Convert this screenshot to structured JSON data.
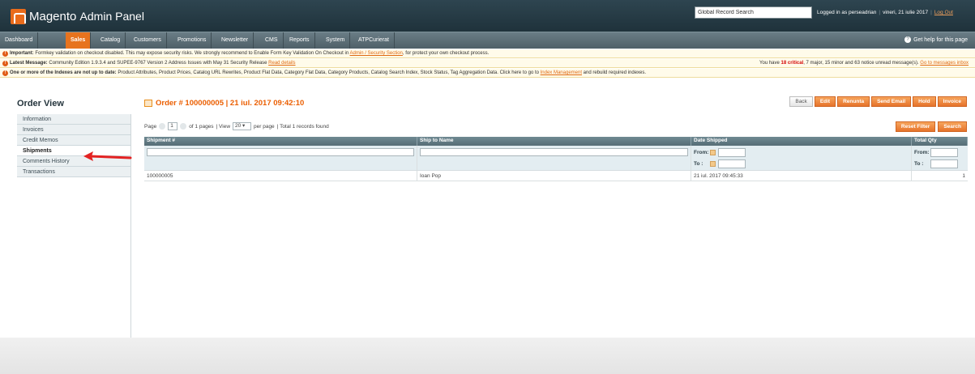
{
  "header": {
    "logo_main": "Magento",
    "logo_sub": "Admin Panel",
    "search_value": "Global Record Search",
    "logged_in": "Logged in as perseadrian",
    "date": "vineri, 21 iulie 2017",
    "logout": "Log Out"
  },
  "nav": {
    "items": [
      "Dashboard",
      "Sales",
      "Catalog",
      "Customers",
      "Promotions",
      "Newsletter",
      "CMS",
      "Reports",
      "System",
      "ATPCurierat"
    ],
    "active": "Sales",
    "help": "Get help for this page"
  },
  "notices": {
    "important_label": "Important:",
    "important_text": "Formkey validation on checkout disabled. This may expose security risks. We strongly recommend to Enable Form Key Validation On Checkout in",
    "important_link": "Admin / Security Section",
    "important_tail": ", for protect your own checkout process.",
    "latest_label": "Latest Message:",
    "latest_text": "Community Edition 1.9.3.4 and SUPEE-9767 Version 2 Address Issues with May 31 Security Release",
    "latest_link": "Read details",
    "latest_right_pre": "You have",
    "latest_right_crit": "18 critical",
    "latest_right_post": ", 7 major, 15 minor and 63 notice unread message(s).",
    "latest_right_link": "Go to messages inbox",
    "index_label": "One or more of the Indexes are not up to date:",
    "index_text": "Product Attributes, Product Prices, Catalog URL Rewrites, Product Flat Data, Category Flat Data, Category Products, Catalog Search Index, Stock Status, Tag Aggregation Data. Click here to go to",
    "index_link": "Index Management",
    "index_tail": "and rebuild required indexes."
  },
  "sidebar": {
    "title": "Order View",
    "tabs": [
      "Information",
      "Invoices",
      "Credit Memos",
      "Shipments",
      "Comments History",
      "Transactions"
    ],
    "active": "Shipments"
  },
  "order": {
    "title": "Order # 100000005 | 21 iul. 2017 09:42:10",
    "buttons": [
      "Back",
      "Edit",
      "Renunta",
      "Send Email",
      "Hold",
      "Invoice"
    ]
  },
  "pager": {
    "page_label": "Page",
    "page_value": "1",
    "of_pages": "of 1 pages",
    "view_label": "| View",
    "per_page_value": "20",
    "per_page_label": "per page",
    "total": "| Total 1 records found",
    "reset": "Reset Filter",
    "search": "Search"
  },
  "grid": {
    "columns": [
      "Shipment #",
      "Ship to Name",
      "Date Shipped",
      "Total Qty"
    ],
    "from_label": "From:",
    "to_label": "To :",
    "rows": [
      {
        "shipment": "100000005",
        "name": "Ioan Pop",
        "date": "21 iul. 2017 09:45:33",
        "qty": "1"
      }
    ]
  }
}
